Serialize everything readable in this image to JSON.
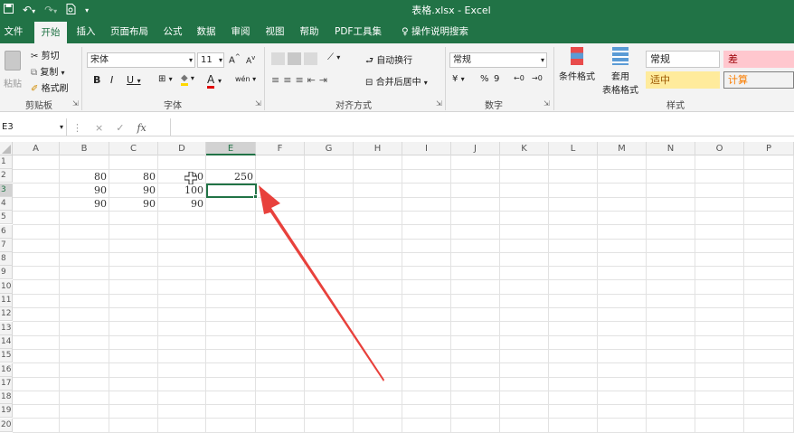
{
  "window": {
    "title": "表格.xlsx  -  Excel"
  },
  "quick_access": {
    "save_icon": "save-icon",
    "undo_icon": "undo-icon",
    "redo_icon": "redo-icon",
    "preview_icon": "print-preview-icon",
    "customize": "▾"
  },
  "tabs": [
    {
      "label": "文件",
      "active": false
    },
    {
      "label": "开始",
      "active": true
    },
    {
      "label": "插入",
      "active": false
    },
    {
      "label": "页面布局",
      "active": false
    },
    {
      "label": "公式",
      "active": false
    },
    {
      "label": "数据",
      "active": false
    },
    {
      "label": "审阅",
      "active": false
    },
    {
      "label": "视图",
      "active": false
    },
    {
      "label": "帮助",
      "active": false
    },
    {
      "label": "PDF工具集",
      "active": false
    }
  ],
  "tell_me": "操作说明搜索",
  "clipboard": {
    "paste": "粘贴",
    "cut": "剪切",
    "copy": "复制",
    "format_painter": "格式刷",
    "group": "剪贴板"
  },
  "font": {
    "name": "宋体",
    "size": "11",
    "grow": "A",
    "shrink": "A",
    "bold": "B",
    "italic": "I",
    "underline": "U",
    "group": "字体",
    "font_color": "A",
    "fill_color": "◆",
    "wen": "wén"
  },
  "alignment": {
    "wrap": "自动换行",
    "merge": "合并后居中",
    "group": "对齐方式"
  },
  "number": {
    "format": "常规",
    "percent": "%",
    "comma": "9",
    "group": "数字"
  },
  "styles": {
    "conditional": "条件格式",
    "table_format_1": "套用",
    "table_format_2": "表格格式",
    "normal": "常规",
    "bad": "差",
    "neutral": "适中",
    "calc": "计算",
    "group": "样式"
  },
  "formula_bar": {
    "name_box": "E3",
    "cancel": "×",
    "enter": "✓",
    "fx": "fx",
    "value": ""
  },
  "columns": [
    "A",
    "B",
    "C",
    "D",
    "E",
    "F",
    "G",
    "H",
    "I",
    "J",
    "K",
    "L",
    "M",
    "N",
    "O",
    "P"
  ],
  "selected_column": "E",
  "rows": [
    "1",
    "2",
    "3",
    "4",
    "5",
    "6",
    "7",
    "8",
    "9",
    "10",
    "11",
    "12",
    "13",
    "14",
    "15",
    "16",
    "17",
    "18",
    "19",
    "20"
  ],
  "selected_row": "3",
  "cells": {
    "B2": "80",
    "C2": "80",
    "D2": "90",
    "E2": "250",
    "B3": "90",
    "C3": "90",
    "D3": "100",
    "B4": "90",
    "C4": "90",
    "D4": "90"
  },
  "colors": {
    "accent": "#217346",
    "annotation_arrow": "#e8413c",
    "bad_fill": "#ffc7ce",
    "bad_text": "#9c0006",
    "neutral_fill": "#ffeb9c",
    "neutral_text": "#9c5700",
    "calc_fill": "#f2f2f2",
    "calc_text": "#fa7d00"
  }
}
